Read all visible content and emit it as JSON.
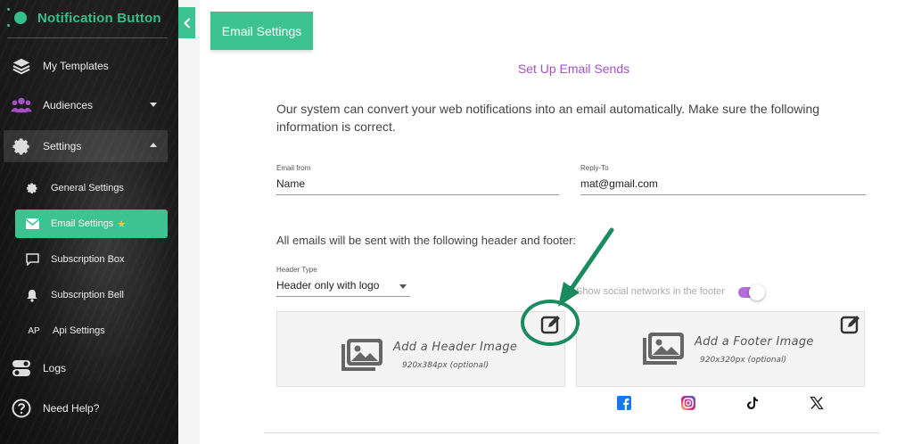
{
  "app": {
    "brand_name": "Notification Button",
    "accent_color": "#3cc391",
    "brand_color": "#33c08c",
    "purple": "#a84fd0"
  },
  "sidebar": {
    "items": [
      {
        "label": "My Templates",
        "icon": "layers-icon"
      },
      {
        "label": "Audiences",
        "icon": "users-icon"
      },
      {
        "label": "Settings",
        "icon": "gear-icon"
      },
      {
        "label": "Logs",
        "icon": "toggle-icon"
      },
      {
        "label": "Need Help?",
        "icon": "help-icon"
      }
    ],
    "sub_items": [
      {
        "label": "General Settings",
        "icon": "gear-icon"
      },
      {
        "label": "Email Settings",
        "icon": "mail-icon",
        "active": true,
        "badge_icon": "star-icon"
      },
      {
        "label": "Subscription Box",
        "icon": "chat-icon"
      },
      {
        "label": "Subscription Bell",
        "icon": "bell-icon"
      },
      {
        "label": "Api Settings",
        "icon_text": "AP"
      }
    ]
  },
  "main": {
    "tab_label": "Email Settings",
    "section_title": "Set Up Email Sends",
    "intro": "Our system can convert your web notifications into an email automatically. Make sure the following information is correct.",
    "email_from": {
      "label": "Email from",
      "value": "Name"
    },
    "reply_to": {
      "label": "Reply-To",
      "value": "mat@gmail.com"
    },
    "header_footer_heading": "All emails will be sent with the following header and footer:",
    "header_type": {
      "label": "Header Type",
      "value": "Header only with logo"
    },
    "social_toggle": {
      "label": "Show social networks in the footer",
      "on": true
    },
    "header_image": {
      "title": "Add a Header Image",
      "size": "920x384px (optional)"
    },
    "footer_image": {
      "title": "Add a Footer Image",
      "size": "920x320px (optional)"
    },
    "social_icons": [
      "facebook-icon",
      "instagram-icon",
      "tiktok-icon",
      "x-icon"
    ]
  }
}
